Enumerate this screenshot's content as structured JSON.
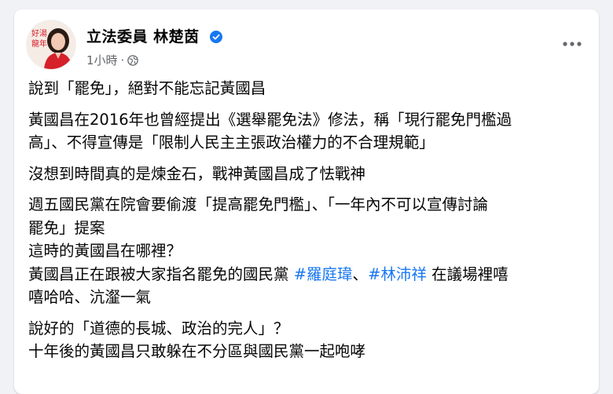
{
  "post": {
    "author": "立法委員 林楚茵",
    "timestamp": "1小時",
    "meta_separator": "·",
    "avatar": {
      "text_line1": "好湯",
      "text_line2": "龍年"
    },
    "paragraphs": [
      [
        "說到「罷免」，絕對不能忘記黃國昌"
      ],
      [
        "黃國昌在2016年也曾經提出《選舉罷免法》修法，稱「現行罷免門檻過",
        "高」、不得宣傳是「限制人民主主張政治權力的不合理規範」"
      ],
      [
        "沒想到時間真的是煉金石，戰神黃國昌成了怯戰神"
      ],
      [
        "週五國民黨在院會要偷渡「提高罷免門檻」、「一年內不可以宣傳討論",
        "罷免」提案",
        "這時的黃國昌在哪裡？"
      ],
      [
        "說好的「道德的長城、政治的完人」？",
        "十年後的黃國昌只敢躲在不分區與國民黨一起咆哮"
      ]
    ],
    "hashtag_paragraph": {
      "before": "黃國昌正在跟被大家指名罷免的國民黨 ",
      "tag1": "#羅庭瑋",
      "sep": "、",
      "tag2": "#林沛祥",
      "after": " 在議場裡嘻",
      "line2": "嘻哈哈、沆瀣一氣"
    }
  },
  "colors": {
    "link": "#1877f2",
    "verified": "#1877f2",
    "text": "#050505",
    "meta": "#65676b",
    "avatar_accent": "#d6202a"
  },
  "icons": [
    "verified-badge-icon",
    "globe-icon",
    "more-options-icon"
  ]
}
